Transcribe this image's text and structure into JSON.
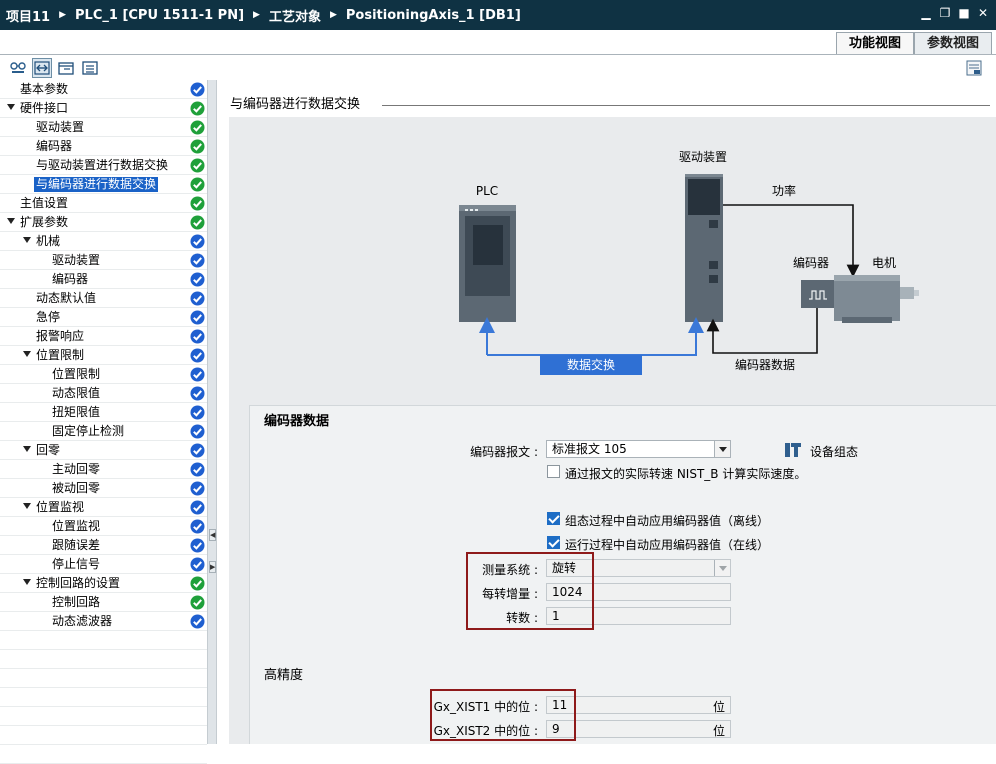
{
  "titlebar": {
    "crumbs": [
      "项目11",
      "PLC_1 [CPU 1511-1 PN]",
      "工艺对象",
      "PositioningAxis_1 [DB1]"
    ]
  },
  "view_tabs": [
    {
      "label": "功能视图",
      "active": true
    },
    {
      "label": "参数视图",
      "active": false
    }
  ],
  "tree": {
    "items": [
      {
        "label": "基本参数",
        "level": 0,
        "arrow": false,
        "status": "blue"
      },
      {
        "label": "硬件接口",
        "level": 0,
        "arrow": true,
        "status": "green"
      },
      {
        "label": "驱动装置",
        "level": 1,
        "arrow": false,
        "status": "green"
      },
      {
        "label": "编码器",
        "level": 1,
        "arrow": false,
        "status": "green"
      },
      {
        "label": "与驱动装置进行数据交换",
        "level": 1,
        "arrow": false,
        "status": "green"
      },
      {
        "label": "与编码器进行数据交换",
        "level": 1,
        "arrow": false,
        "status": "green",
        "selected": true
      },
      {
        "label": "主值设置",
        "level": 0,
        "arrow": false,
        "status": "green"
      },
      {
        "label": "扩展参数",
        "level": 0,
        "arrow": true,
        "status": "green"
      },
      {
        "label": "机械",
        "level": 1,
        "arrow": true,
        "status": "blue"
      },
      {
        "label": "驱动装置",
        "level": 2,
        "arrow": false,
        "status": "blue"
      },
      {
        "label": "编码器",
        "level": 2,
        "arrow": false,
        "status": "blue"
      },
      {
        "label": "动态默认值",
        "level": 1,
        "arrow": false,
        "status": "blue"
      },
      {
        "label": "急停",
        "level": 1,
        "arrow": false,
        "status": "blue"
      },
      {
        "label": "报警响应",
        "level": 1,
        "arrow": false,
        "status": "blue"
      },
      {
        "label": "位置限制",
        "level": 1,
        "arrow": true,
        "status": "blue"
      },
      {
        "label": "位置限制",
        "level": 2,
        "arrow": false,
        "status": "blue"
      },
      {
        "label": "动态限值",
        "level": 2,
        "arrow": false,
        "status": "blue"
      },
      {
        "label": "扭矩限值",
        "level": 2,
        "arrow": false,
        "status": "blue"
      },
      {
        "label": "固定停止检测",
        "level": 2,
        "arrow": false,
        "status": "blue"
      },
      {
        "label": "回零",
        "level": 1,
        "arrow": true,
        "status": "blue"
      },
      {
        "label": "主动回零",
        "level": 2,
        "arrow": false,
        "status": "blue"
      },
      {
        "label": "被动回零",
        "level": 2,
        "arrow": false,
        "status": "blue"
      },
      {
        "label": "位置监视",
        "level": 1,
        "arrow": true,
        "status": "blue"
      },
      {
        "label": "位置监视",
        "level": 2,
        "arrow": false,
        "status": "blue"
      },
      {
        "label": "跟随误差",
        "level": 2,
        "arrow": false,
        "status": "blue"
      },
      {
        "label": "停止信号",
        "level": 2,
        "arrow": false,
        "status": "blue"
      },
      {
        "label": "控制回路的设置",
        "level": 1,
        "arrow": true,
        "status": "green"
      },
      {
        "label": "控制回路",
        "level": 2,
        "arrow": false,
        "status": "green"
      },
      {
        "label": "动态滤波器",
        "level": 2,
        "arrow": false,
        "status": "blue"
      }
    ],
    "empty_rows": 7
  },
  "section": {
    "title": "与编码器进行数据交换"
  },
  "diagram": {
    "plc_label": "PLC",
    "drive_label": "驱动装置",
    "power_label": "功率",
    "encoder_label": "编码器",
    "motor_label": "电机",
    "exchange_label": "数据交换",
    "encoder_data_label": "编码器数据"
  },
  "encoder_data": {
    "title": "编码器数据",
    "telegram_label": "编码器报文 :",
    "telegram_value": "标准报文 105",
    "device_config_label": "设备组态",
    "nist_checkbox": {
      "label": "通过报文的实际转速 NIST_B 计算实际速度。",
      "checked": false
    },
    "offline_checkbox": {
      "label": "组态过程中自动应用编码器值（离线）",
      "checked": true
    },
    "online_checkbox": {
      "label": "运行过程中自动应用编码器值（在线）",
      "checked": true
    },
    "measuring_system_label": "测量系统 :",
    "measuring_system_value": "旋转",
    "increments_label": "每转增量 :",
    "increments_value": "1024",
    "revolutions_label": "转数 :",
    "revolutions_value": "1"
  },
  "precision": {
    "title": "高精度",
    "xist1_label": "Gx_XIST1 中的位 :",
    "xist1_value": "11",
    "xist2_label": "Gx_XIST2 中的位 :",
    "xist2_value": "9",
    "unit": "位"
  },
  "colors": {
    "status_green": "#1fa03a",
    "status_blue": "#1f5fd0",
    "title_bg": "#0f3243",
    "arrow_blue": "#3a78d8",
    "highlight_box": "#8e1a1a"
  }
}
